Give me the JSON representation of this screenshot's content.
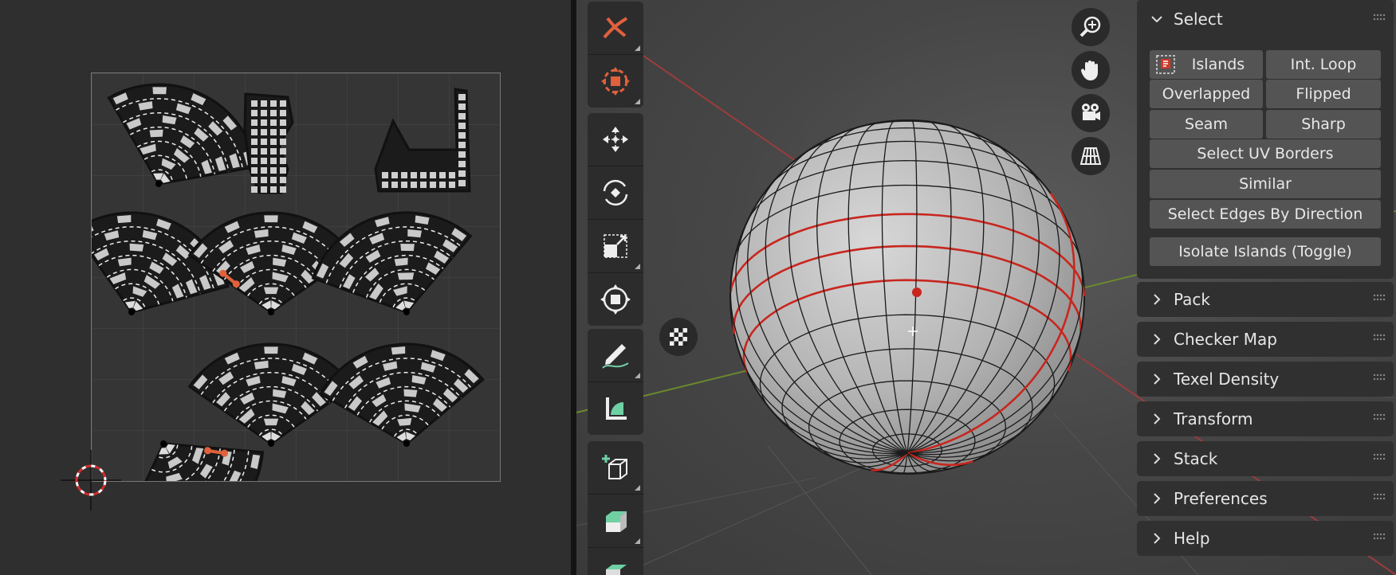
{
  "uv_editor": {
    "cursor_icon": "cursor-2d-icon"
  },
  "toolbar": {
    "tools": [
      {
        "name": "tool-select-icon"
      },
      {
        "name": "tool-cursor-icon"
      },
      {
        "name": "tool-move-icon"
      },
      {
        "name": "tool-rotate-icon"
      },
      {
        "name": "tool-scale-icon"
      },
      {
        "name": "tool-transform-icon"
      },
      {
        "name": "tool-annotate-icon"
      },
      {
        "name": "tool-measure-icon"
      },
      {
        "name": "tool-add-cube-icon"
      },
      {
        "name": "tool-extrude-icon"
      }
    ]
  },
  "navigation": [
    "zoom-icon",
    "hand-pan-icon",
    "camera-icon",
    "perspective-grid-icon"
  ],
  "select_panel": {
    "title": "Select",
    "buttons": {
      "islands": "Islands",
      "int_loop": "Int. Loop",
      "overlapped": "Overlapped",
      "flipped": "Flipped",
      "seam": "Seam",
      "sharp": "Sharp",
      "select_uv_borders": "Select UV Borders",
      "similar": "Similar",
      "select_edges_by_direction": "Select Edges By Direction",
      "isolate_islands": "Isolate Islands (Toggle)"
    }
  },
  "collapsed_panels": [
    "Pack",
    "Checker Map",
    "Texel Density",
    "Transform",
    "Stack",
    "Preferences",
    "Help"
  ],
  "colors": {
    "seam_red": "#c8261e",
    "accent_orange": "#e0613c",
    "x_axis": "#9b3c3c",
    "y_axis": "#6b8a2e"
  }
}
